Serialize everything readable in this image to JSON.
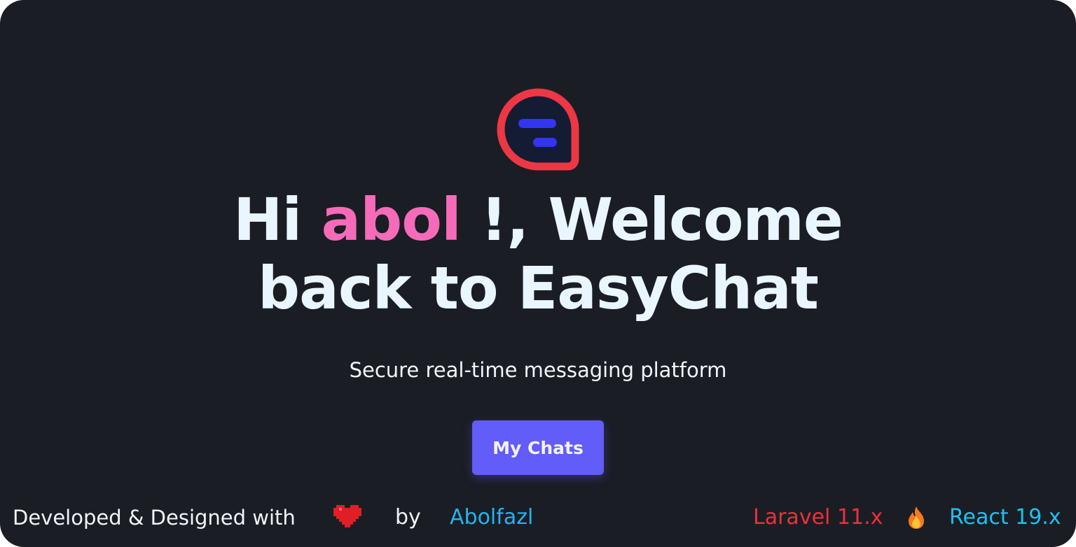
{
  "logo": {
    "icon": "chat-bubble-icon",
    "ring_color": "#ee3744",
    "bars_color": "#3334f4"
  },
  "heading": {
    "greeting": "Hi ",
    "username": "abol",
    "suffix": " !, Welcome",
    "line2": "back to EasyChat"
  },
  "tagline": "Secure real-time messaging platform",
  "cta": {
    "label": "My Chats"
  },
  "footer": {
    "developed_text": "Developed & Designed with",
    "heart_icon": "heart-icon",
    "by_text": "by",
    "author": "Abolfazl",
    "laravel": "Laravel 11.x",
    "fire_icon": "fire-icon",
    "react": "React 19.x"
  },
  "colors": {
    "background": "#1a1d24",
    "accent": "#625cf8",
    "username": "#f56bb9",
    "laravel": "#ef2f3a",
    "react": "#1fc1ef",
    "author": "#22b5ef"
  }
}
